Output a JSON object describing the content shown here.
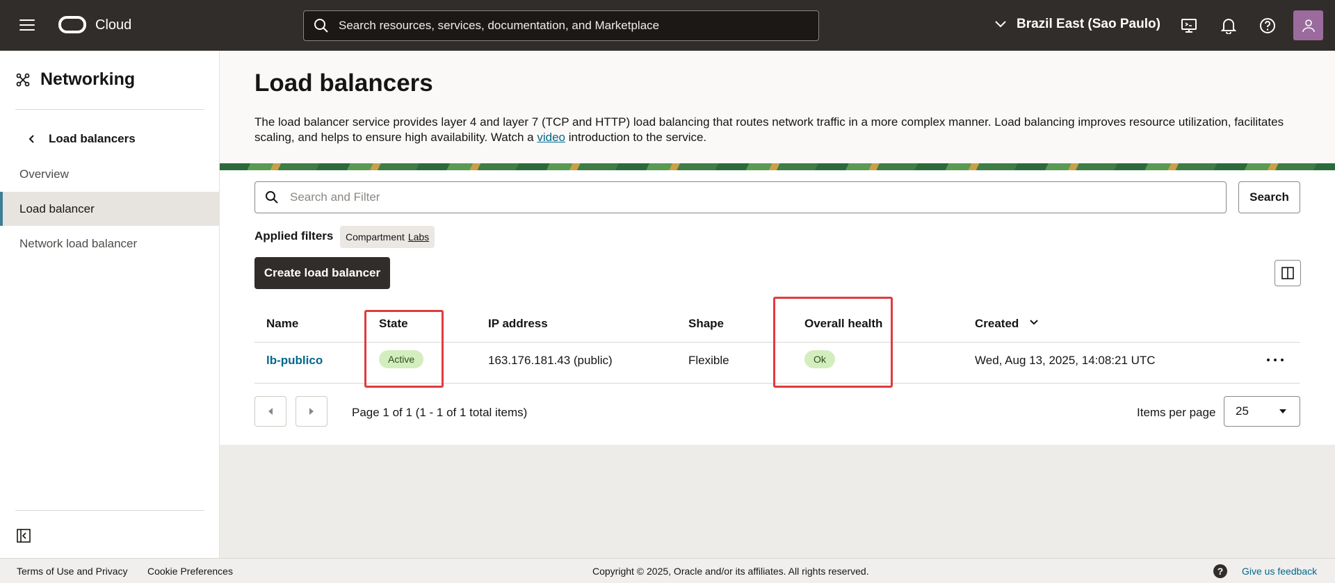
{
  "topbar": {
    "brand": "Cloud",
    "search_placeholder": "Search resources, services, documentation, and Marketplace",
    "region": "Brazil East (Sao Paulo)"
  },
  "sidebar": {
    "title": "Networking",
    "back_label": "Load balancers",
    "items": [
      {
        "label": "Overview",
        "active": false
      },
      {
        "label": "Load balancer",
        "active": true
      },
      {
        "label": "Network load balancer",
        "active": false
      }
    ]
  },
  "page": {
    "title": "Load balancers",
    "description_before": "The load balancer service provides layer 4 and layer 7 (TCP and HTTP) load balancing that routes network traffic in a more complex manner. Load balancing improves resource utilization, facilitates scaling, and helps to ensure high availability. Watch a ",
    "description_link": "video",
    "description_after": " introduction to the service."
  },
  "filters": {
    "placeholder": "Search and Filter",
    "search_button": "Search",
    "applied_label": "Applied filters",
    "chip_key": "Compartment",
    "chip_value": "Labs"
  },
  "actions": {
    "create_button": "Create load balancer"
  },
  "table": {
    "columns": [
      "Name",
      "State",
      "IP address",
      "Shape",
      "Overall health",
      "Created"
    ],
    "rows": [
      {
        "name": "lb-publico",
        "state": "Active",
        "ip": "163.176.181.43 (public)",
        "shape": "Flexible",
        "health": "Ok",
        "created": "Wed, Aug 13, 2025, 14:08:21 UTC"
      }
    ]
  },
  "pagination": {
    "text": "Page 1 of 1 (1 - 1 of 1 total items)",
    "items_per_page_label": "Items per page",
    "items_per_page_value": "25"
  },
  "footer": {
    "terms": "Terms of Use and Privacy",
    "cookies": "Cookie Preferences",
    "copyright": "Copyright © 2025, Oracle and/or its affiliates. All rights reserved.",
    "help_symbol": "?",
    "feedback": "Give us feedback"
  },
  "colors": {
    "topbar": "#312d2a",
    "accent_link": "#00688c",
    "highlight": "#e03a3e",
    "badge_bg": "#d4edbf"
  }
}
